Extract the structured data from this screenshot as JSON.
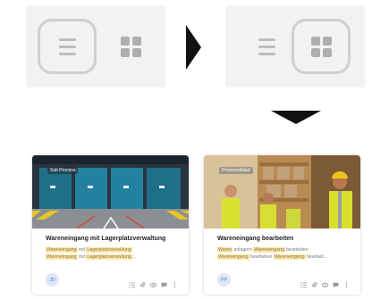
{
  "toggle_before": {
    "list_active": true,
    "list_icon": "list-icon",
    "grid_icon": "grid-icon"
  },
  "toggle_after": {
    "grid_active": true,
    "list_icon": "list-icon",
    "grid_icon": "grid-icon"
  },
  "arrows": {
    "right": "arrow-right-icon",
    "down": "arrow-down-icon"
  },
  "cards": [
    {
      "badge": "Sub Process",
      "title": "Wareneingang mit Lagerplatzverwaltung",
      "desc_lines": [
        [
          {
            "t": "Wareneingang",
            "h": true
          },
          {
            "t": " mit ",
            "h": false
          },
          {
            "t": "Lagerplatzverwaltung",
            "h": true
          }
        ],
        [
          {
            "t": "Wareneingang",
            "h": true
          },
          {
            "t": " mit ",
            "h": false
          },
          {
            "t": "Lagerplatzverwaltung",
            "h": true
          },
          {
            "t": "...",
            "h": false
          }
        ]
      ],
      "avatar": "JD"
    },
    {
      "badge": "Prozessablauf",
      "title": "Wareneingang bearbeiten",
      "desc_lines": [
        [
          {
            "t": "Waren",
            "h": true
          },
          {
            "t": " anlagern ",
            "h": false
          },
          {
            "t": "Wareneingang",
            "h": true
          },
          {
            "t": " bearbeiten",
            "h": false
          }
        ],
        [
          {
            "t": "Wareneingang",
            "h": true
          },
          {
            "t": " bearbeiten ",
            "h": false
          },
          {
            "t": "Wareneingang",
            "h": true
          },
          {
            "t": " bearbeit...",
            "h": false
          }
        ]
      ],
      "avatar": "PP"
    }
  ],
  "card_actions": [
    "checklist-icon",
    "paperclip-icon",
    "eye-icon",
    "comment-icon",
    "more-vertical-icon"
  ]
}
